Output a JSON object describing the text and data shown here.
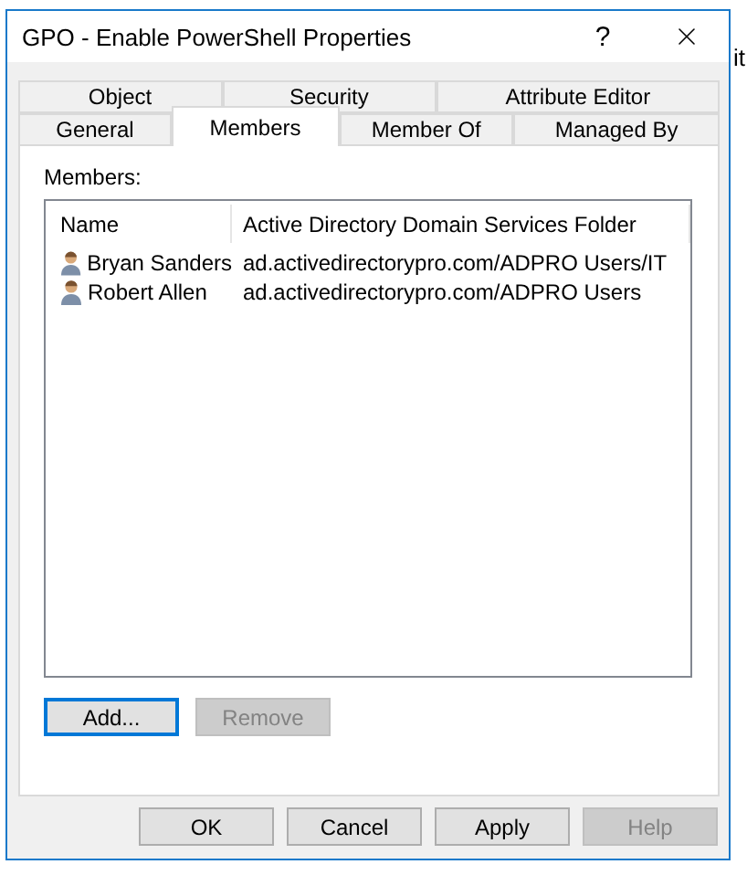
{
  "background": {
    "text": "it"
  },
  "window": {
    "title": "GPO - Enable PowerShell Properties",
    "help": "?"
  },
  "tab_rows": [
    {
      "tabs": [
        {
          "label": "Object",
          "selected": false
        },
        {
          "label": "Security",
          "selected": false
        },
        {
          "label": "Attribute Editor",
          "selected": false
        }
      ]
    },
    {
      "tabs": [
        {
          "label": "General",
          "selected": false
        },
        {
          "label": "Members",
          "selected": true
        },
        {
          "label": "Member Of",
          "selected": false
        },
        {
          "label": "Managed By",
          "selected": false
        }
      ]
    }
  ],
  "members": {
    "label": "Members:",
    "columns": [
      "Name",
      "Active Directory Domain Services Folder"
    ],
    "rows": [
      {
        "name": "Bryan Sanders",
        "folder": "ad.activedirectorypro.com/ADPRO Users/IT"
      },
      {
        "name": "Robert Allen",
        "folder": "ad.activedirectorypro.com/ADPRO Users"
      }
    ],
    "buttons": [
      {
        "label": "Add...",
        "disabled": false,
        "focused": true
      },
      {
        "label": "Remove",
        "disabled": true,
        "focused": false
      }
    ]
  },
  "buttons": [
    {
      "label": "OK",
      "disabled": false
    },
    {
      "label": "Cancel",
      "disabled": false
    },
    {
      "label": "Apply",
      "disabled": false
    },
    {
      "label": "Help",
      "disabled": true
    }
  ]
}
